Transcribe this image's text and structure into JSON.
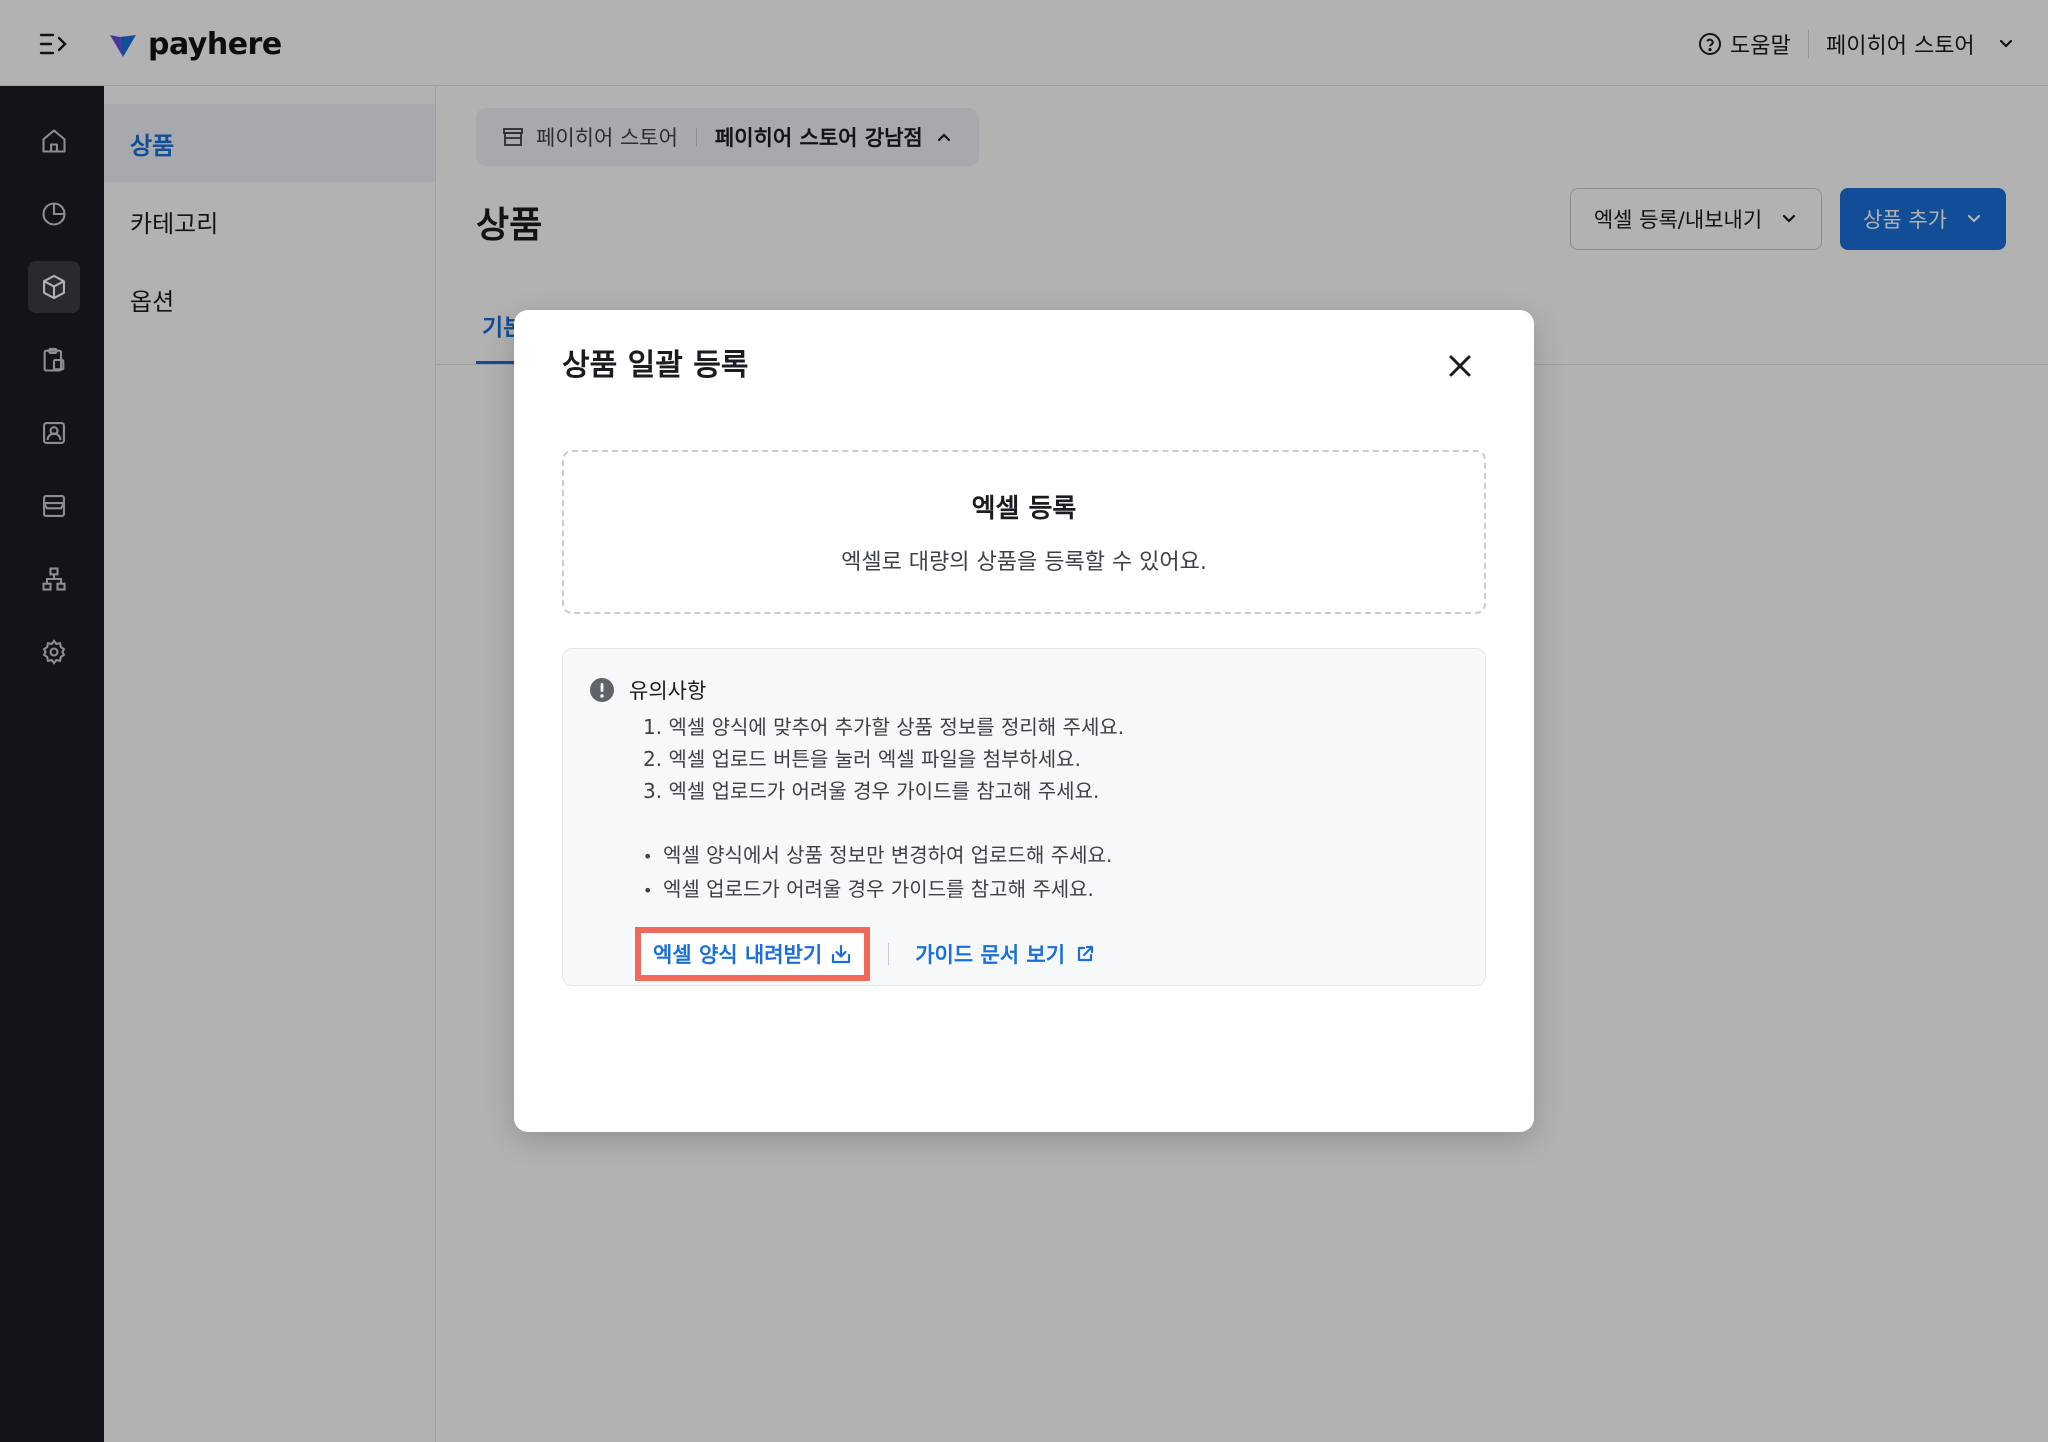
{
  "topbar": {
    "logo_text": "payhere",
    "help_label": "도움말",
    "store_name": "페이히어 스토어"
  },
  "rail": {
    "items": [
      {
        "icon": "home-icon",
        "active": false
      },
      {
        "icon": "pie-chart-icon",
        "active": false
      },
      {
        "icon": "box-icon",
        "active": true
      },
      {
        "icon": "clipboard-icon",
        "active": false
      },
      {
        "icon": "contact-icon",
        "active": false
      },
      {
        "icon": "store-icon",
        "active": false
      },
      {
        "icon": "org-chart-icon",
        "active": false
      },
      {
        "icon": "gear-icon",
        "active": false
      }
    ]
  },
  "subnav": {
    "items": [
      {
        "label": "상품",
        "active": true
      },
      {
        "label": "카테고리",
        "active": false
      },
      {
        "label": "옵션",
        "active": false
      }
    ]
  },
  "main": {
    "breadcrumb": {
      "store": "페이히어 스토어",
      "branch": "페이히어 스토어 강남점"
    },
    "title": "상품",
    "excel_button": "엑셀 등록/내보내기",
    "add_button": "상품 추가",
    "tab_basic": "기본"
  },
  "modal": {
    "title": "상품 일괄 등록",
    "dropzone": {
      "title": "엑셀 등록",
      "description": "엑셀로 대량의 상품을 등록할 수 있어요."
    },
    "notice": {
      "heading": "유의사항",
      "steps": [
        "1. 엑셀 양식에 맞추어 추가할 상품 정보를 정리해 주세요.",
        "2. 엑셀 업로드 버튼을 눌러 엑셀 파일을 첨부하세요.",
        "3. 엑셀 업로드가 어려울 경우 가이드를 참고해 주세요."
      ],
      "bullets": [
        "엑셀 양식에서 상품 정보만 변경하여 업로드해 주세요.",
        "엑셀 업로드가 어려울 경우 가이드를 참고해 주세요."
      ],
      "download_link": "엑셀 양식 내려받기",
      "guide_link": "가이드 문서 보기"
    }
  },
  "colors": {
    "brand_blue": "#1b6fd8",
    "rail_bg": "#1b1d22",
    "highlight_box": "#ef6a5c"
  }
}
